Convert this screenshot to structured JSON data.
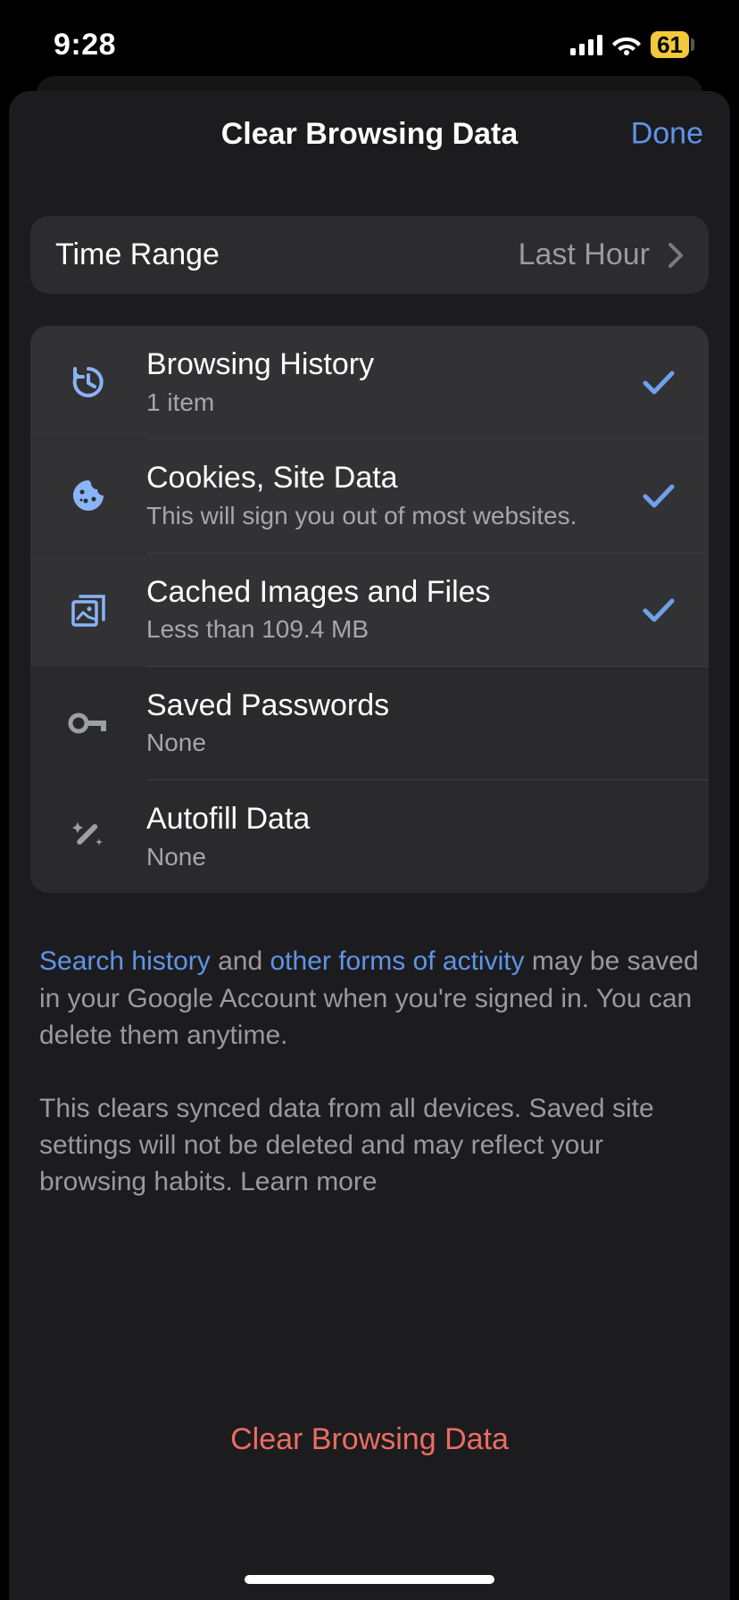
{
  "status": {
    "time": "9:28",
    "battery": "61"
  },
  "header": {
    "title": "Clear Browsing Data",
    "done": "Done"
  },
  "timeRange": {
    "label": "Time Range",
    "value": "Last Hour"
  },
  "items": [
    {
      "title": "Browsing History",
      "sub": "1 item",
      "checked": true,
      "icon": "history"
    },
    {
      "title": "Cookies, Site Data",
      "sub": "This will sign you out of most websites.",
      "checked": true,
      "icon": "cookie"
    },
    {
      "title": "Cached Images and Files",
      "sub": "Less than 109.4 MB",
      "checked": true,
      "icon": "images"
    },
    {
      "title": "Saved Passwords",
      "sub": "None",
      "checked": false,
      "icon": "key"
    },
    {
      "title": "Autofill Data",
      "sub": "None",
      "checked": false,
      "icon": "wand"
    }
  ],
  "footer1": {
    "link1": "Search history",
    "mid1": " and ",
    "link2": "other forms of activity",
    "rest": " may be saved in your Google Account when you're signed in. You can delete them anytime."
  },
  "footer2": {
    "text": "This clears synced data from all devices. Saved site settings will not be deleted and may reflect your browsing habits. ",
    "link": "Learn more"
  },
  "clearButton": "Clear Browsing Data",
  "colors": {
    "accent": "#5f94e8",
    "destructive": "#eb6d63",
    "iconSelected": "#8ab4f8",
    "iconUnselected": "#9aa0a6"
  }
}
